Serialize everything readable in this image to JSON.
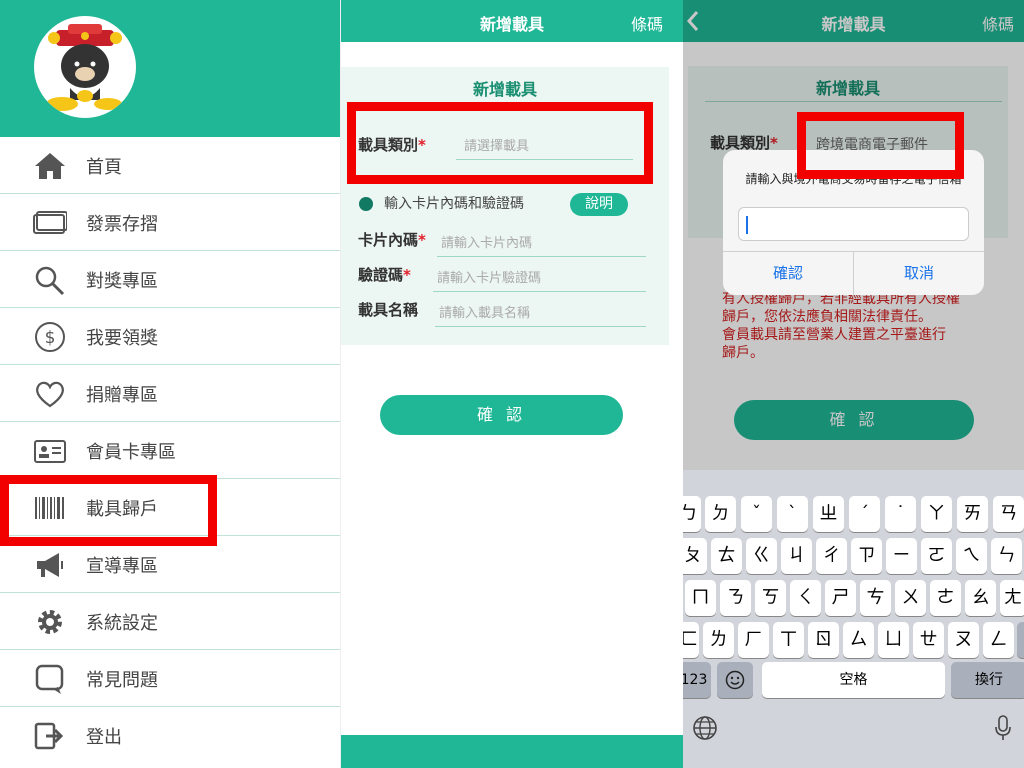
{
  "panel1": {
    "menu": [
      {
        "label": "首頁",
        "icon": "home-icon"
      },
      {
        "label": "發票存摺",
        "icon": "cards-icon"
      },
      {
        "label": "對獎專區",
        "icon": "magnifier-icon"
      },
      {
        "label": "我要領獎",
        "icon": "dollar-icon"
      },
      {
        "label": "捐贈專區",
        "icon": "heart-icon"
      },
      {
        "label": "會員卡專區",
        "icon": "member-card-icon"
      },
      {
        "label": "載具歸戶",
        "icon": "barcode-icon"
      },
      {
        "label": "宣導專區",
        "icon": "megaphone-icon"
      },
      {
        "label": "系統設定",
        "icon": "gear-icon"
      },
      {
        "label": "常見問題",
        "icon": "question-bubble-icon"
      },
      {
        "label": "登出",
        "icon": "logout-icon"
      }
    ]
  },
  "panel2": {
    "nav_title": "新增載具",
    "nav_right": "條碼",
    "card_title": "新增載具",
    "carrier_type_label": "載具類別",
    "carrier_type_placeholder": "請選擇載具",
    "option_text": "輸入卡片內碼和驗證碼",
    "help_button": "說明",
    "card_code_label": "卡片內碼",
    "card_code_placeholder": "請輸入卡片內碼",
    "verify_label": "驗證碼",
    "verify_placeholder": "請輸入卡片驗證碼",
    "name_label": "載具名稱",
    "name_placeholder": "請輸入載具名稱",
    "confirm_button": "確 認"
  },
  "panel3": {
    "nav_title": "新增載具",
    "nav_right": "條碼",
    "card_title": "新增載具",
    "carrier_type_label": "載具類別",
    "carrier_type_value": "跨境電商電子郵件",
    "warning_lines": [
      "有人授權歸戶，若非經載具所有人授權",
      "歸戶，您依法應負相關法律責任。",
      "會員載具請至營業人建置之平臺進行",
      "歸戶。"
    ],
    "alert_message": "請輸入與境外電商交易時留存之電子信箱",
    "alert_confirm": "確認",
    "alert_cancel": "取消",
    "confirm_button": "確 認",
    "keyboard": {
      "row1": [
        "ㄉ",
        "ˇ",
        "ˋ",
        "ㄓ",
        "ˊ",
        "˙",
        "ㄚ",
        "ㄞ",
        "ㄢ"
      ],
      "row2": [
        "ㄆ",
        "ㄊ",
        "ㄍ",
        "ㄐ",
        "ㄔ",
        "ㄗ",
        "ㄧ",
        "ㄛ",
        "ㄟ",
        "ㄣ"
      ],
      "row3": [
        "ㄇ",
        "ㄋ",
        "ㄎ",
        "ㄑ",
        "ㄕ",
        "ㄘ",
        "ㄨ",
        "ㄜ",
        "ㄠ",
        "ㄤ"
      ],
      "row4": [
        "ㄈ",
        "ㄌ",
        "ㄏ",
        "ㄒ",
        "ㄖ",
        "ㄙ",
        "ㄩ",
        "ㄝ",
        "ㄡ",
        "ㄥ"
      ],
      "num_key": "123",
      "space_key": "空格",
      "return_key": "換行"
    }
  },
  "colors": {
    "brand": "#1fb795",
    "highlight": "#f20000",
    "warning": "#d42020"
  }
}
